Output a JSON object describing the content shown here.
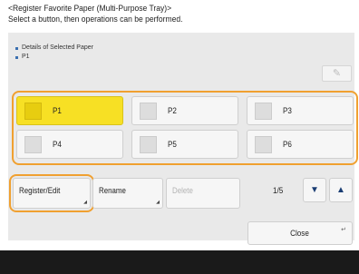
{
  "header": {
    "title_line1": "<Register Favorite Paper (Multi-Purpose Tray)>",
    "title_line2": "Select a button, then operations can be performed."
  },
  "details": {
    "heading": "Details of Selected Paper",
    "value": "P1"
  },
  "corner_button": {
    "icon": "paper-settings-icon"
  },
  "papers": [
    {
      "label": "P1",
      "selected": true
    },
    {
      "label": "P2",
      "selected": false
    },
    {
      "label": "P3",
      "selected": false
    },
    {
      "label": "P4",
      "selected": false
    },
    {
      "label": "P5",
      "selected": false
    },
    {
      "label": "P6",
      "selected": false
    }
  ],
  "actions": {
    "register_edit": "Register/Edit",
    "rename": "Rename",
    "delete": "Delete"
  },
  "pagination": {
    "indicator": "1/5",
    "down_icon": "triangle-down-icon",
    "up_icon": "triangle-up-icon"
  },
  "close_label": "Close",
  "colors": {
    "accent_focus": "#f0a030",
    "selected_fill": "#f7e024",
    "panel_bg": "#e9e9e9",
    "arrow_color": "#1a3d73",
    "bottom_bar": "#1a1a1a"
  }
}
